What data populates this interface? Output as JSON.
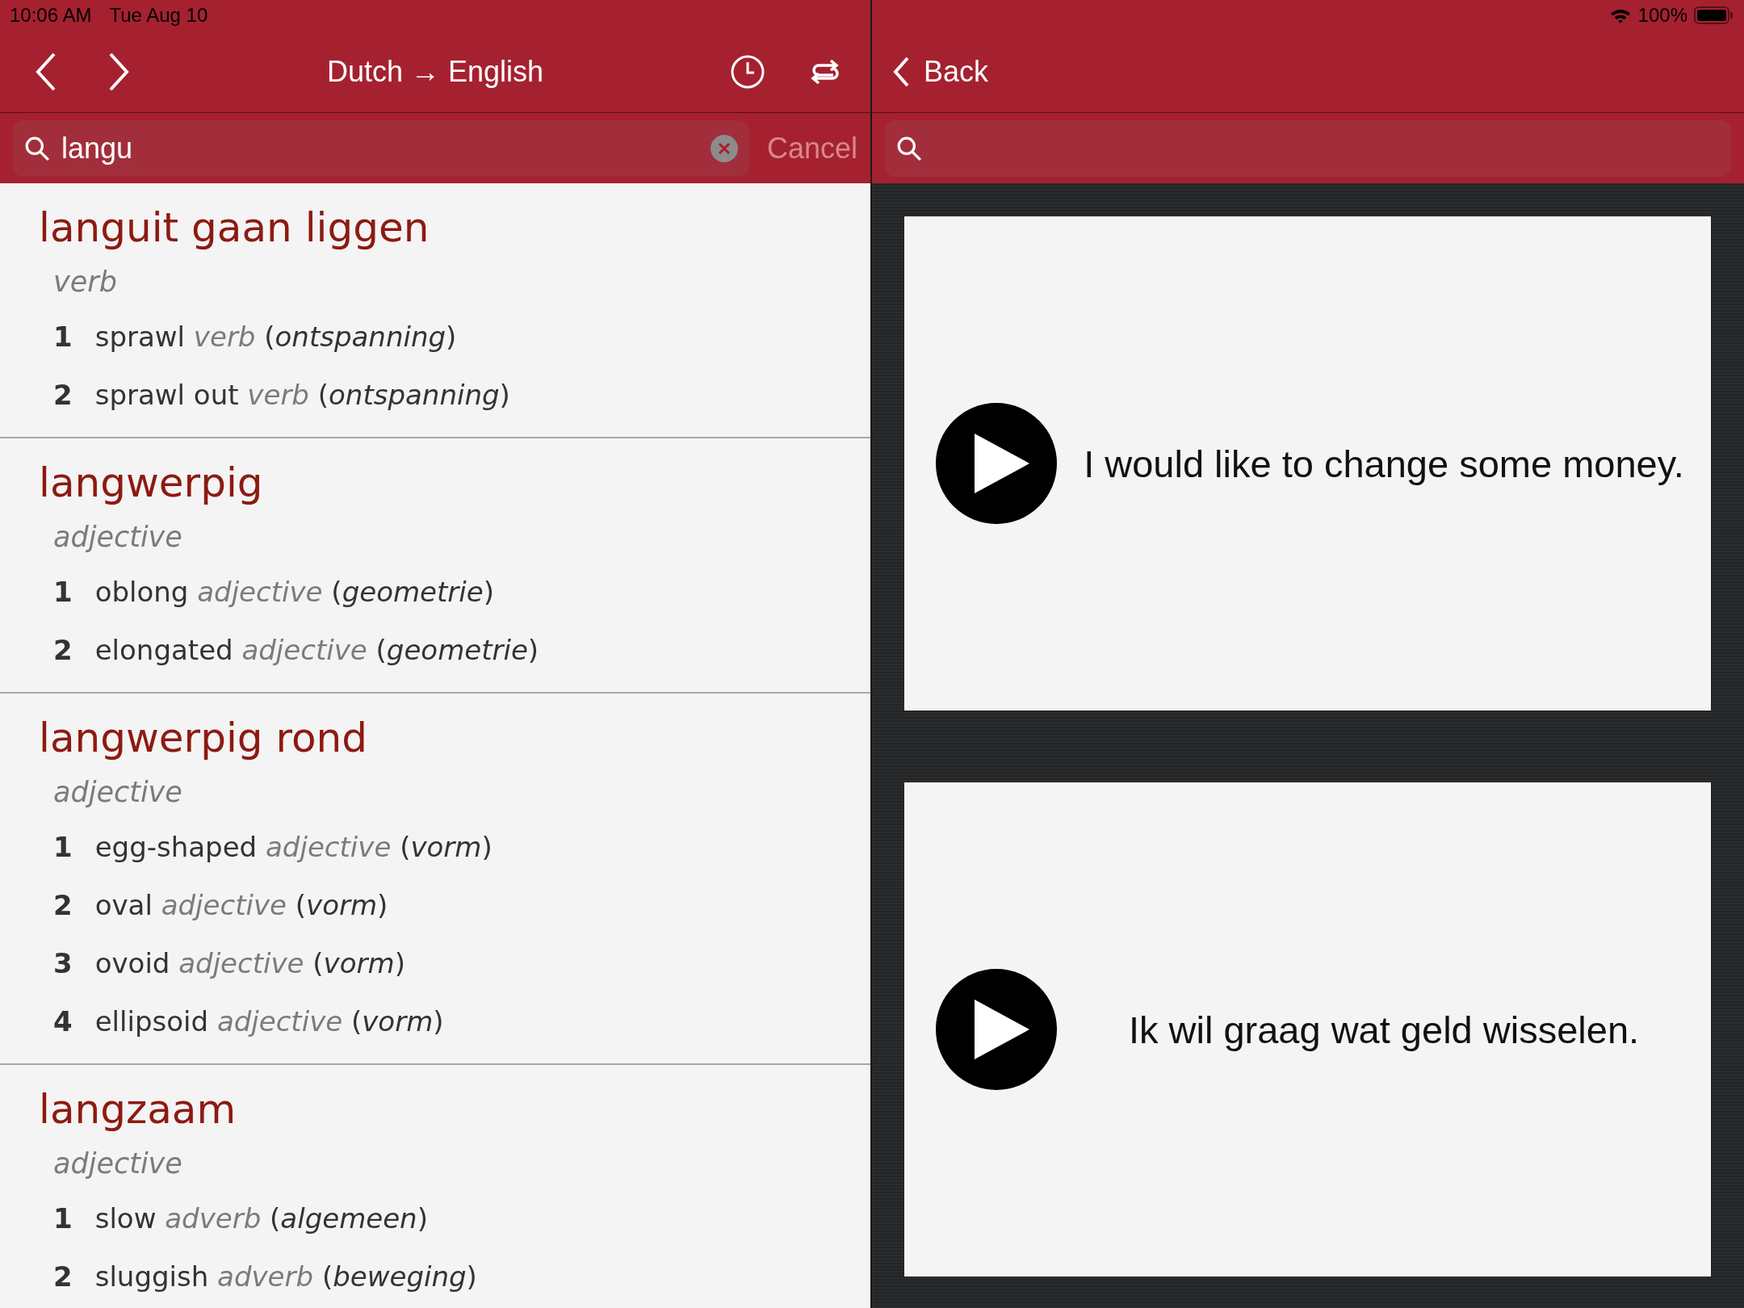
{
  "status_bar": {
    "time": "10:06 AM",
    "date": "Tue Aug 10",
    "battery": "100%"
  },
  "nav": {
    "title": "Dutch → English",
    "back": "Back"
  },
  "search": {
    "value": "langu",
    "cancel": "Cancel"
  },
  "entries": [
    {
      "headword": "languit gaan liggen",
      "pos": "verb",
      "senses": [
        {
          "number": "1",
          "word": "sprawl",
          "pos": "verb",
          "domain": "(*ontspanning*)"
        },
        {
          "number": "2",
          "word": "sprawl out",
          "pos": "verb",
          "domain": "(*ontspanning*)"
        }
      ]
    },
    {
      "headword": "langwerpig",
      "pos": "adjective",
      "senses": [
        {
          "number": "1",
          "word": "oblong",
          "pos": "adjective",
          "domain": "(*geometrie*)"
        },
        {
          "number": "2",
          "word": "elongated",
          "pos": "adjective",
          "domain": "(*geometrie*)"
        }
      ]
    },
    {
      "headword": "langwerpig rond",
      "pos": "adjective",
      "senses": [
        {
          "number": "1",
          "word": "egg-shaped",
          "pos": "adjective",
          "domain": "(*vorm*)"
        },
        {
          "number": "2",
          "word": "oval",
          "pos": "adjective",
          "domain": "(*vorm*)"
        },
        {
          "number": "3",
          "word": "ovoid",
          "pos": "adjective",
          "domain": "(*vorm*)"
        },
        {
          "number": "4",
          "word": "ellipsoid",
          "pos": "adjective",
          "domain": "(*vorm*)"
        }
      ]
    },
    {
      "headword": "langzaam",
      "pos": "adjective",
      "senses": [
        {
          "number": "1",
          "word": "slow",
          "pos": "adverb",
          "domain": "(*algemeen*)"
        },
        {
          "number": "2",
          "word": "sluggish",
          "pos": "adverb",
          "domain": "(*beweging*)"
        }
      ]
    }
  ],
  "cards": [
    {
      "sentence": "I would like to change some money."
    },
    {
      "sentence": "Ik wil graag wat geld wisselen."
    }
  ]
}
